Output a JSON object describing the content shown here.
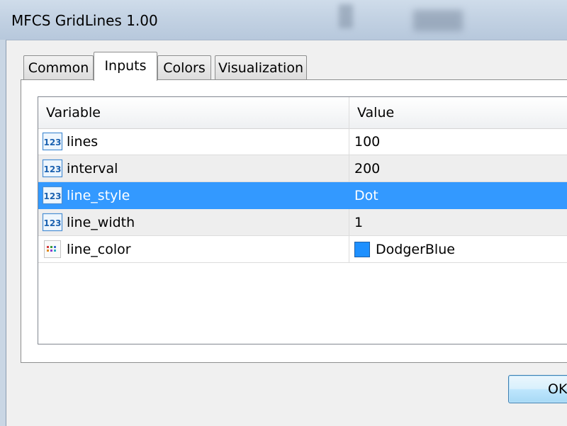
{
  "window": {
    "title": "MFCS GridLines 1.00"
  },
  "tabs": [
    {
      "label": "Common",
      "active": false
    },
    {
      "label": "Inputs",
      "active": true
    },
    {
      "label": "Colors",
      "active": false
    },
    {
      "label": "Visualization",
      "active": false
    }
  ],
  "table": {
    "columns": [
      "Variable",
      "Value"
    ],
    "rows": [
      {
        "icon": "numeric-123-icon",
        "variable": "lines",
        "value": "100"
      },
      {
        "icon": "numeric-123-icon",
        "variable": "interval",
        "value": "200"
      },
      {
        "icon": "numeric-123-icon",
        "variable": "line_style",
        "value": "Dot",
        "selected": true
      },
      {
        "icon": "numeric-123-icon",
        "variable": "line_width",
        "value": "1"
      },
      {
        "icon": "color-palette-icon",
        "variable": "line_color",
        "value": "DodgerBlue",
        "swatch": "#1e90ff"
      }
    ]
  },
  "buttons": {
    "ok_label": "OK"
  },
  "colors": {
    "selection": "#3399ff",
    "accent_swatch": "#1e90ff"
  }
}
